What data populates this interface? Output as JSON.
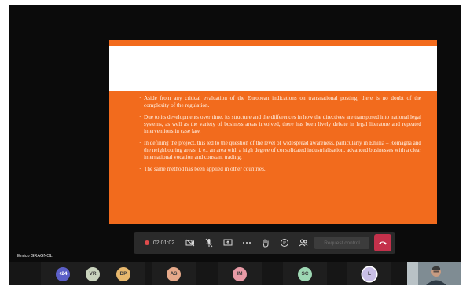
{
  "slide": {
    "bullets": [
      "Aside from any critical evaluation of the European indications on transnational posting, there is no doubt of the complexity of the regulation.",
      "Due to its developments over time, its structure and the differences in how the directives are transposed into national legal systems, as well as the variety of business areas involved, there has been lively debate in legal literature and repeated interventions in case law.",
      "In defining the project, this led to the question of the level of widespread awareness, particularly in Emilia – Romagna and the neighbouring areas, i. e., an area with a high degree of consolidated industrialisation, advanced businesses with a clear international vocation and constant trading.",
      "The same method has been applied in other countries."
    ]
  },
  "controls": {
    "timer": "02:01:02",
    "request_control": "Request control"
  },
  "speaker": {
    "name": "Enrico GRAGNOLI"
  },
  "participants": [
    {
      "initials": "+24",
      "color": "#5b5fc7"
    },
    {
      "initials": "VR",
      "color": "#c9d3bd"
    },
    {
      "initials": "DP",
      "color": "#e8b86d"
    },
    {
      "initials": "AS",
      "color": "#e6a98a"
    },
    {
      "initials": "IM",
      "color": "#e89aa6"
    },
    {
      "initials": "SC",
      "color": "#9ed8b4"
    },
    {
      "initials": "L",
      "color": "#c9bfe6"
    }
  ],
  "colors": {
    "slide_orange": "#f26b1d",
    "hangup": "#c4314b"
  }
}
